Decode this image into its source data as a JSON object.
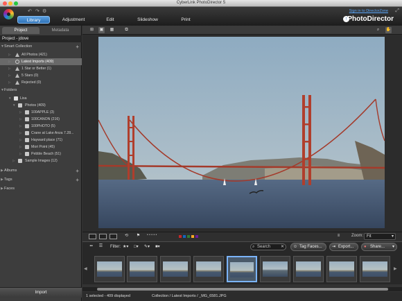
{
  "window": {
    "title": "CyberLink PhotoDirector 5"
  },
  "menu": {
    "tabs": [
      {
        "label": "Library"
      },
      {
        "label": "Adjustment"
      },
      {
        "label": "Edit"
      },
      {
        "label": "Slideshow"
      },
      {
        "label": "Print"
      }
    ],
    "signin_link": "Sign in to DirectorZone",
    "brand": "PhotoDirector"
  },
  "left_panel": {
    "tabs": [
      "Project",
      "Metadata"
    ],
    "project_title": "Project - jdove",
    "smart_collection": {
      "label": "Smart Collection",
      "items": [
        {
          "label": "All Photos (421)"
        },
        {
          "label": "Latest Imports (409)"
        },
        {
          "label": "1 Star or Better (1)"
        },
        {
          "label": "5 Stars (0)"
        },
        {
          "label": "Rejected (0)"
        }
      ]
    },
    "folders": {
      "label": "Folders",
      "root": "Lisa",
      "photos": "Photos (409)",
      "items": [
        {
          "label": "100APPLE (3)"
        },
        {
          "label": "100CANON (216)"
        },
        {
          "label": "100PHOTO (5)"
        },
        {
          "label": "Crane at Lake Anza 7.28..."
        },
        {
          "label": "Hayward place (71)"
        },
        {
          "label": "Mori Point (45)"
        },
        {
          "label": "Pebble Beach (51)"
        }
      ],
      "sample": "Sample Images (12)"
    },
    "albums": "Albums",
    "tags": "Tags",
    "faces": "Faces",
    "import_button": "Import"
  },
  "bottom": {
    "zoom_label": "Zoom:",
    "zoom_value": "Fit",
    "filter_label": "Filter:",
    "search_placeholder": "Search",
    "tag_faces": "Tag Faces...",
    "export": "Export...",
    "share": "Share...",
    "color_labels": [
      "#c62828",
      "#1565c0",
      "#2e7d32",
      "#f9a825",
      "#6a1b9a"
    ]
  },
  "status": {
    "selected": "1 selected - 409 displayed",
    "path": "Collection / Latest Imports / _MG_6581.JPG"
  }
}
